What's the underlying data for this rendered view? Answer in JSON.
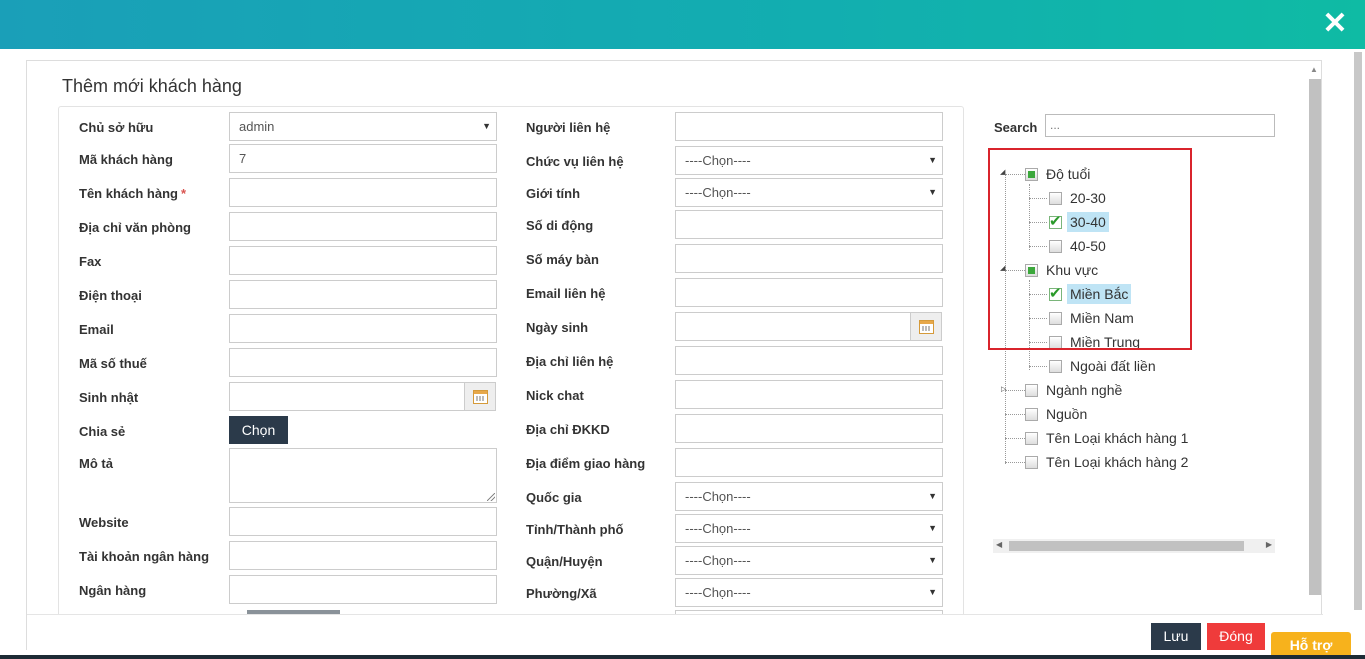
{
  "modal": {
    "title": "Thêm mới khách hàng"
  },
  "left_form": {
    "owner_label": "Chủ sở hữu",
    "owner_value": "admin",
    "code_label": "Mã khách hàng",
    "code_value": "7",
    "name_label": "Tên khách hàng",
    "required_mark": "*",
    "office_address_label": "Địa chỉ văn phòng",
    "fax_label": "Fax",
    "phone_label": "Điện thoại",
    "email_label": "Email",
    "tax_label": "Mã số thuế",
    "birthday_label": "Sinh nhật",
    "share_label": "Chia sẻ",
    "choose_button": "Chọn",
    "description_label": "Mô tả",
    "website_label": "Website",
    "bank_account_label": "Tài khoản ngân hàng",
    "bank_label": "Ngân hàng"
  },
  "mid_form": {
    "contact_label": "Người liên hệ",
    "contact_position_label": "Chức vụ liên hệ",
    "gender_label": "Giới tính",
    "mobile_label": "Số di động",
    "desk_phone_label": "Số máy bàn",
    "contact_email_label": "Email liên hệ",
    "dob_label": "Ngày sinh",
    "contact_address_label": "Địa chỉ liên hệ",
    "nickchat_label": "Nick chat",
    "biz_address_label": "Địa chỉ ĐKKD",
    "delivery_label": "Địa điểm giao hàng",
    "country_label": "Quốc gia",
    "province_label": "Tỉnh/Thành phố",
    "district_label": "Quận/Huyện",
    "ward_label": "Phường/Xã",
    "select_placeholder": "----Chọn----"
  },
  "tree": {
    "search_label": "Search",
    "search_placeholder": "...",
    "nodes": {
      "age": "Độ tuổi",
      "age_20_30": "20-30",
      "age_30_40": "30-40",
      "age_40_50": "40-50",
      "region": "Khu vực",
      "north": "Miền Bắc",
      "south": "Miền Nam",
      "central": "Miền Trung",
      "overseas": "Ngoài đất liền",
      "industry": "Ngành nghề",
      "source": "Nguồn",
      "type1": "Tên Loại khách hàng 1",
      "type2": "Tên Loại khách hàng 2"
    }
  },
  "footer": {
    "save": "Lưu",
    "close": "Đóng"
  },
  "support": "Hỗ trợ",
  "colors": {
    "accent": "#12aeb0",
    "dark_button": "#2b3a4a",
    "danger": "#ef3b3b",
    "support": "#f7b21c",
    "highlight": "#bfe4f5",
    "callout": "#d9242c"
  }
}
